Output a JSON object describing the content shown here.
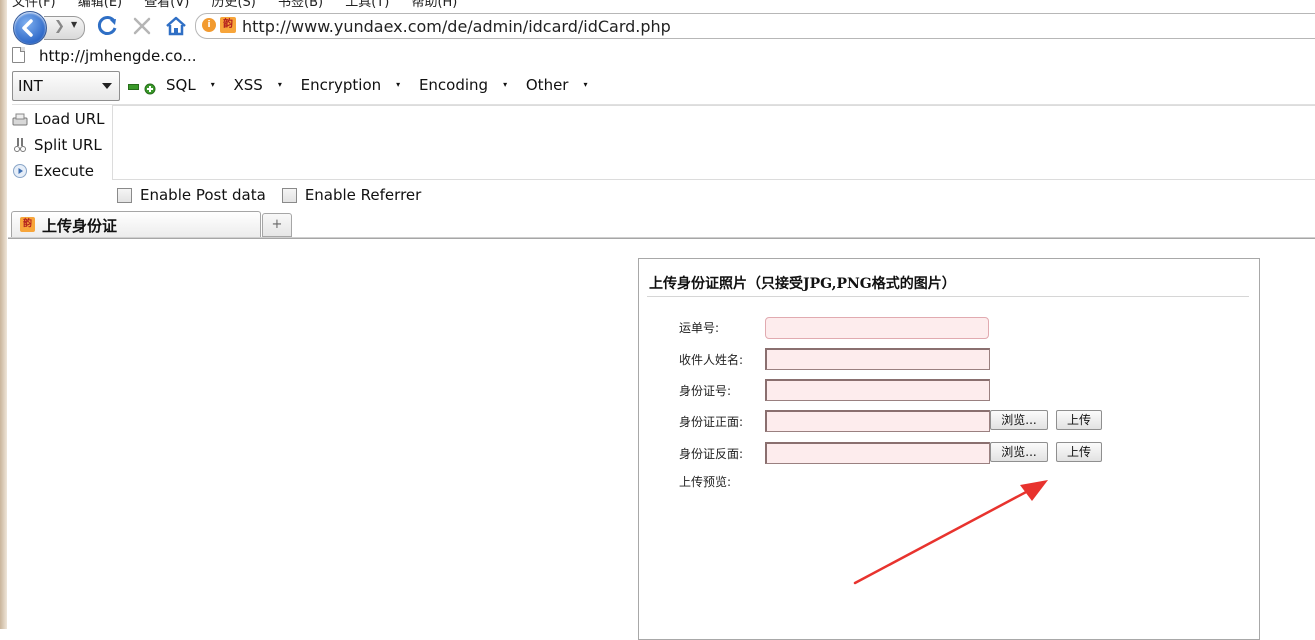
{
  "menu": {
    "items": [
      "文件(F)",
      "编辑(E)",
      "查看(V)",
      "历史(S)",
      "书签(B)",
      "工具(T)",
      "帮助(H)"
    ]
  },
  "nav": {
    "url": "http://www.yundaex.com/de/admin/idcard/idCard.php"
  },
  "bookmark": {
    "label": "http://jmhengde.co..."
  },
  "hackbar": {
    "select_value": "INT",
    "menus": [
      "SQL",
      "XSS",
      "Encryption",
      "Encoding",
      "Other"
    ],
    "actions": {
      "load_url": "Load URL",
      "split_url": "Split URL",
      "execute": "Execute"
    },
    "enable_post": "Enable Post data",
    "enable_referrer": "Enable Referrer"
  },
  "tab": {
    "title": "上传身份证",
    "new_tab_symbol": "+"
  },
  "form": {
    "title": "上传身份证照片（只接受JPG,PNG格式的图片）",
    "fields": {
      "waybill": "运单号:",
      "recipient_name": "收件人姓名:",
      "id_number": "身份证号:",
      "id_front": "身份证正面:",
      "id_back": "身份证反面:",
      "preview": "上传预览:"
    },
    "browse_label": "浏览...",
    "upload_label": "上传"
  },
  "colors": {
    "input_bg": "#fdeced",
    "annotation_arrow": "#e8332e"
  }
}
